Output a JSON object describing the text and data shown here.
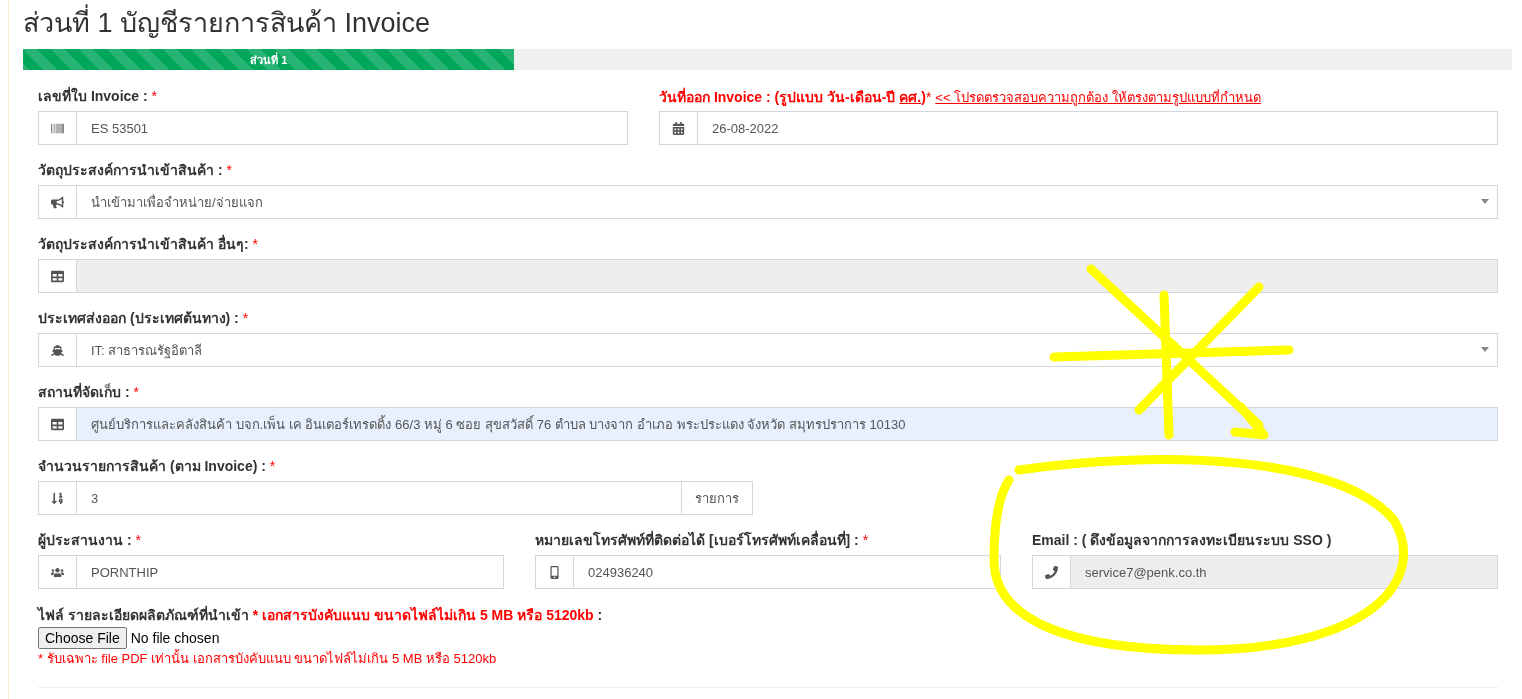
{
  "title": "ส่วนที่ 1 บัญชีรายการสินค้า Invoice",
  "progress": {
    "label": "ส่วนที่ 1",
    "level": 0.33
  },
  "rows": [
    {
      "fields": [
        {
          "kind": "text",
          "label": "เลขที่ใบ Invoice : ",
          "mark": "*",
          "value": "ES 53501",
          "warning": false
        },
        {
          "kind": "text",
          "label": "วันที่ออก Invoice : (รูปแบบ วัน-เดือน-ปี ",
          "label_underlined": "คศ.",
          "label_tail": ")",
          "mark": "*",
          "link": "<< โปรดตรวจสอบความถูกต้อง ให้ตรงตามรูปแบบที่กำหนด",
          "value": "26-08-2022",
          "warning": true
        }
      ]
    },
    {
      "fields": [
        {
          "kind": "select",
          "label": "วัตถุประสงค์การนำเข้าสินค้า : ",
          "mark": "*",
          "value": "นำเข้ามาเพื่อจำหน่าย/จ่ายแจก",
          "warning": false
        }
      ]
    },
    {
      "fields": [
        {
          "kind": "disabled",
          "label": "วัตถุประสงค์การนำเข้าสินค้า อื่นๆ: ",
          "mark": "*",
          "warning": false
        }
      ]
    },
    {
      "fields": [
        {
          "kind": "select",
          "label": "ประเทศส่งออก (ประเทศต้นทาง) : ",
          "mark": "*",
          "value": "IT: สาธารณรัฐอิตาลี",
          "warning": false
        }
      ]
    },
    {
      "fields": [
        {
          "kind": "filled",
          "label": "สถานที่จัดเก็บ : ",
          "mark": "*",
          "value": "ศูนย์บริการและคลังสินค้า บจก.เพ็น เค อินเตอร์เทรดดิ้ง 66/3 หมู่ 6 ซอย สุขสวัสดิ์ 76 ตำบล บางจาก อำเภอ พระประแดง จังหวัด สมุทรปราการ 10130",
          "warning": false
        }
      ]
    },
    {
      "fields": [
        {
          "kind": "suffix",
          "label": "จำนวนรายการสินค้า (ตาม Invoice) : ",
          "mark": "*",
          "value": "3",
          "suffix": "รายการ",
          "warning": false
        }
      ]
    },
    {
      "fields": [
        {
          "kind": "text",
          "label": "ผู้ประสานงาน : ",
          "mark": "*",
          "value": "PORNTHIP",
          "warning": false
        },
        {
          "kind": "text",
          "label": "หมายเลขโทรศัพท์ที่ติดต่อได้ [เบอร์โทรศัพท์เคลื่อนที่] : ",
          "mark": "*",
          "value": "024936240",
          "warning": false
        },
        {
          "kind": "disabled",
          "label": "Email : ( ดึงข้อมูลจากการลงทะเบียนระบบ SSO )",
          "value": "service7@penk.co.th",
          "warning": false
        }
      ]
    }
  ],
  "file": {
    "label": "ไฟล์ รายละเอียดผลิตภัณฑ์ที่นำเข้า ",
    "note": "* เอกสารบังคับแนบ ขนาดไฟล์ไม่เกิน 5 MB หรือ 5120kb",
    "tail": " :",
    "button": "Choose File",
    "status": "No file chosen",
    "hint": "* รับเฉพาะ file PDF เท่านั้น เอกสารบังคับแนบ ขนาดไฟล์ไม่เกิน 5 MB หรือ 5120kb"
  }
}
